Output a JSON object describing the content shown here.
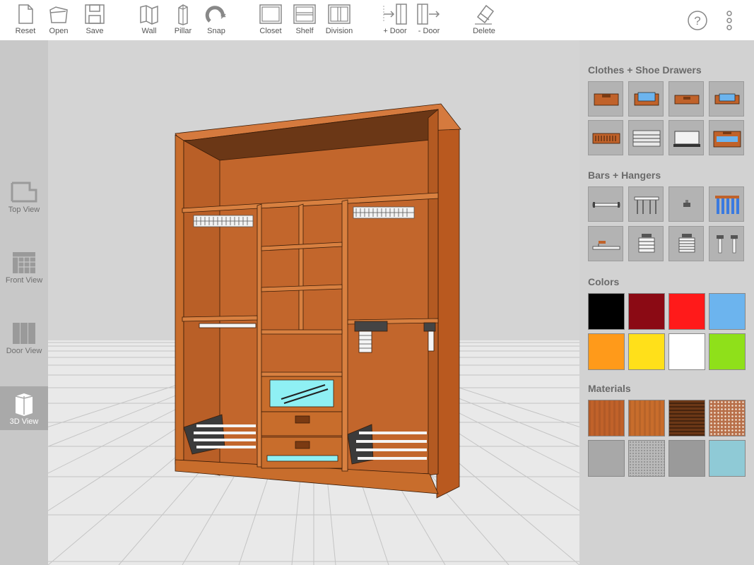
{
  "toolbar": {
    "reset": "Reset",
    "open": "Open",
    "save": "Save",
    "wall": "Wall",
    "pillar": "Pillar",
    "snap": "Snap",
    "closet": "Closet",
    "shelf": "Shelf",
    "division": "Division",
    "add_door": "+ Door",
    "remove_door": "- Door",
    "delete": "Delete",
    "help": "?",
    "more": "⋮"
  },
  "views": {
    "top": "Top View",
    "front": "Front View",
    "door": "Door View",
    "threed": "3D View",
    "active": "3D View"
  },
  "panel": {
    "drawers_title": "Clothes + Shoe Drawers",
    "bars_title": "Bars + Hangers",
    "colors_title": "Colors",
    "materials_title": "Materials",
    "colors": [
      "#000000",
      "#8b0a14",
      "#ff1a1a",
      "#6cb4ee",
      "#ff9a1a",
      "#ffe01a",
      "#ffffff",
      "#8fe01a"
    ],
    "materials": [
      "#c0622a",
      "#c86d2c",
      "#6b3716",
      "#b8704a",
      "#a8a8a8",
      "#b9b9b9",
      "#9a9a9a",
      "#8fcad6"
    ]
  },
  "accent": {
    "wood": "#c0622a",
    "wood_dark": "#8a4318",
    "glass": "#8ff0f4",
    "active_view": "#a9a9a9"
  }
}
